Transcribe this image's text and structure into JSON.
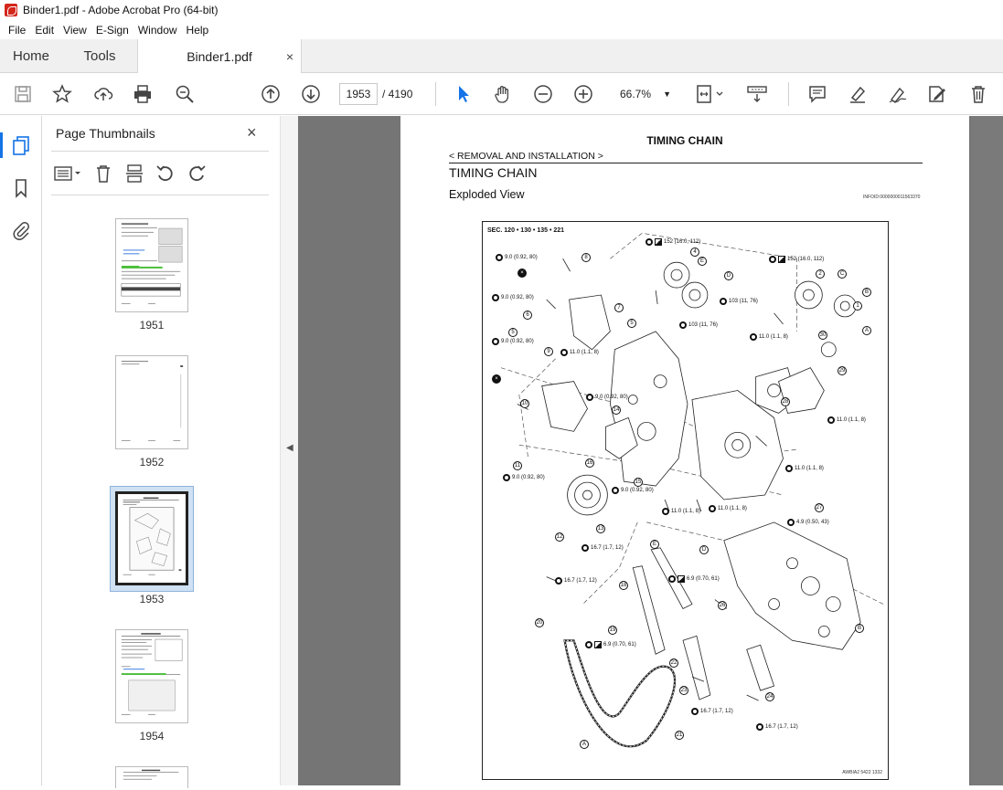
{
  "window": {
    "title": "Binder1.pdf - Adobe Acrobat Pro (64-bit)"
  },
  "menu": [
    "File",
    "Edit",
    "View",
    "E-Sign",
    "Window",
    "Help"
  ],
  "tabs": {
    "home": "Home",
    "tools": "Tools",
    "document": "Binder1.pdf",
    "close": "×"
  },
  "toolbar": {
    "current_page": "1953",
    "page_total": "/  4190",
    "zoom": "66.7%"
  },
  "thumbnails_panel": {
    "title": "Page Thumbnails",
    "close": "×",
    "pages": [
      {
        "label": "1951"
      },
      {
        "label": "1952"
      },
      {
        "label": "1953",
        "selected": true
      },
      {
        "label": "1954"
      }
    ]
  },
  "document_page": {
    "header": "TIMING CHAIN",
    "breadcrumb": "< REMOVAL AND INSTALLATION >",
    "section_title": "TIMING CHAIN",
    "subsection": "Exploded View",
    "info_id": "INFOID:0000000011563370",
    "figure": {
      "sec": "SEC. 120 • 130 • 135 • 221",
      "code": "AWBIA2 5422 1332",
      "callouts": [
        "9.0 (0.92, 80)",
        "152 (16.0, 112)",
        "152 (16.0, 112)",
        "103 (11, 76)",
        "103 (11, 76)",
        "9.0 (0.92, 80)",
        "9.0 (0.92, 80)",
        "11.0 (1.1, 8)",
        "11.0 (1.1, 8)",
        "9.0 (0.92, 80)",
        "11.0 (1.1, 8)",
        "9.0 (0.92, 80)",
        "11.0 (1.1, 8)",
        "9.0 (0.92, 80)",
        "11.0 (1.1, 8)",
        "11.0 (1.1, 8)",
        "4.9 (0.50, 43)",
        "16.7 (1.7, 12)",
        "16.7 (1.7, 12)",
        "6.9 (0.70, 61)",
        "6.9 (0.70, 61)",
        "16.7 (1.7, 12)",
        "16.7 (1.7, 12)"
      ]
    }
  },
  "colors": {
    "accent": "#1473e6",
    "doc_bg": "#757575",
    "acrobat_red": "#d4261c"
  }
}
